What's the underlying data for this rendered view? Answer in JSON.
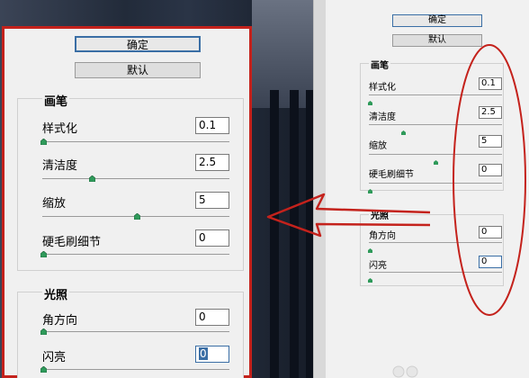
{
  "left_panel": {
    "confirm_label": "确定",
    "default_label": "默认",
    "brush_group": {
      "title": "画笔",
      "items": [
        {
          "label": "样式化",
          "value": "0.1",
          "level": 0.0
        },
        {
          "label": "清洁度",
          "value": "2.5",
          "level": 0.25
        },
        {
          "label": "缩放",
          "value": "5",
          "level": 0.5
        },
        {
          "label": "硬毛刷细节",
          "value": "0",
          "level": 0.0
        }
      ]
    },
    "light_group": {
      "title": "光照",
      "items": [
        {
          "label": "角方向",
          "value": "0",
          "level": 0.0
        },
        {
          "label": "闪亮",
          "value": "0",
          "level": 0.0
        }
      ]
    }
  },
  "right_panel": {
    "confirm_label": "确定",
    "default_label": "默认",
    "brush_group": {
      "title": "画笔",
      "items": [
        {
          "label": "样式化",
          "value": "0.1",
          "level": 0.0
        },
        {
          "label": "清洁度",
          "value": "2.5",
          "level": 0.25
        },
        {
          "label": "缩放",
          "value": "5",
          "level": 0.5
        },
        {
          "label": "硬毛刷细节",
          "value": "0",
          "level": 0.0
        }
      ]
    },
    "light_group": {
      "title": "光照",
      "items": [
        {
          "label": "角方向",
          "value": "0",
          "level": 0.0
        },
        {
          "label": "闪亮",
          "value": "0",
          "level": 0.0
        }
      ]
    }
  },
  "colors": {
    "annotation_red": "#c4221c",
    "button_border_blue": "#3a6ea5",
    "slider_thumb": "#2f9a5a"
  }
}
